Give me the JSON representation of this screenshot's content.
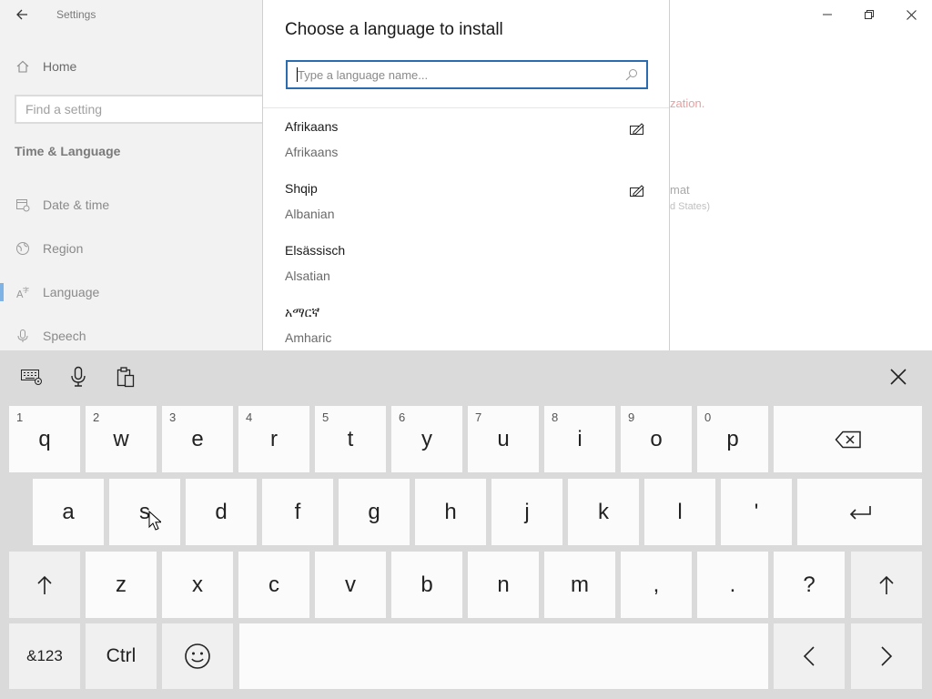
{
  "settings": {
    "title": "Settings",
    "home_label": "Home",
    "search_placeholder": "Find a setting",
    "section": "Time & Language",
    "nav": [
      "Date & time",
      "Region",
      "Language",
      "Speech"
    ],
    "fragments": {
      "red": "zation.",
      "gray1": "mat",
      "gray2": "d States)"
    }
  },
  "dialog": {
    "title": "Choose a language to install",
    "search_placeholder": "Type a language name...",
    "languages": [
      {
        "native": "Afrikaans",
        "english": "Afrikaans",
        "handwriting": true
      },
      {
        "native": "Shqip",
        "english": "Albanian",
        "handwriting": true
      },
      {
        "native": "Elsässisch",
        "english": "Alsatian",
        "handwriting": false
      },
      {
        "native": "አማርኛ",
        "english": "Amharic",
        "handwriting": false
      }
    ]
  },
  "keyboard": {
    "row1": [
      {
        "label": "q",
        "sub": "1"
      },
      {
        "label": "w",
        "sub": "2"
      },
      {
        "label": "e",
        "sub": "3"
      },
      {
        "label": "r",
        "sub": "4"
      },
      {
        "label": "t",
        "sub": "5"
      },
      {
        "label": "y",
        "sub": "6"
      },
      {
        "label": "u",
        "sub": "7"
      },
      {
        "label": "i",
        "sub": "8"
      },
      {
        "label": "o",
        "sub": "9"
      },
      {
        "label": "p",
        "sub": "0"
      }
    ],
    "row2": [
      "a",
      "s",
      "d",
      "f",
      "g",
      "h",
      "j",
      "k",
      "l",
      "'"
    ],
    "row3": [
      "z",
      "x",
      "c",
      "v",
      "b",
      "n",
      "m",
      ",",
      ".",
      "?"
    ],
    "symbols_label": "&123",
    "ctrl_label": "Ctrl"
  },
  "colors": {
    "accent": "#2b6cb0",
    "selection": "#7fb3e6"
  }
}
